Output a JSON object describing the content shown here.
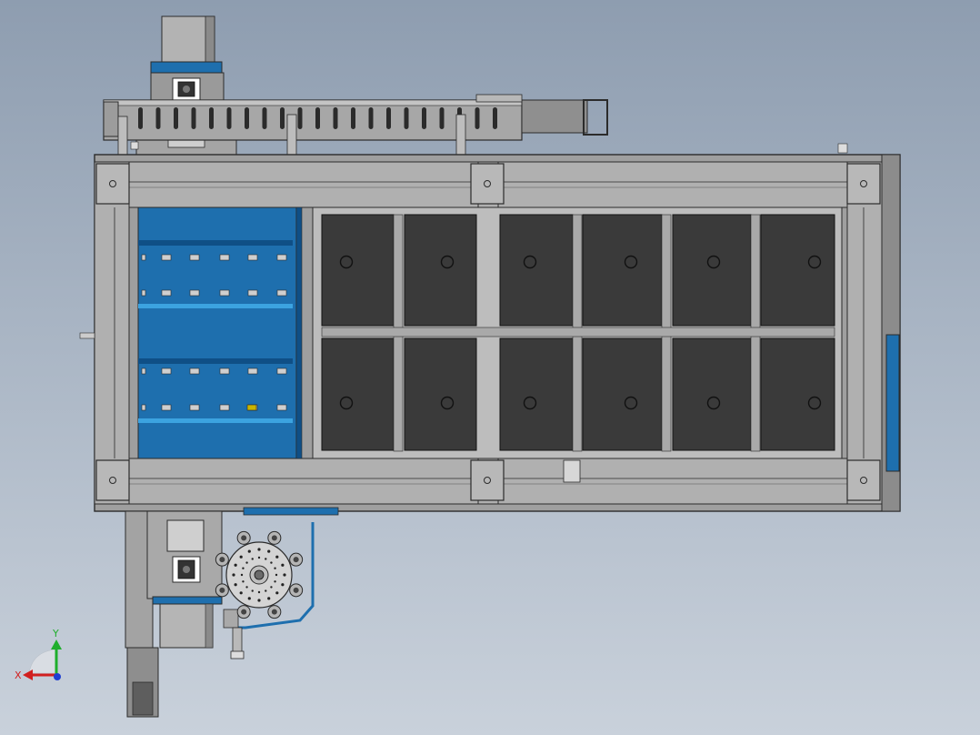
{
  "viewport": {
    "background_top": "#8e9db0",
    "background_bottom": "#c9d1db"
  },
  "colors": {
    "steel": "#a9a9a9",
    "steel_light": "#c4c4c4",
    "steel_dark": "#7c7c7c",
    "edge": "#2b2b2b",
    "panel_dark": "#3a3a3a",
    "blue": "#1e6fae",
    "blue_dark": "#0f4f86",
    "blue_light": "#3ca3e0",
    "axis_x": "#d11f1f",
    "axis_y": "#1fae2c",
    "axis_z": "#1f3fd1"
  },
  "triad": {
    "x_label": "X",
    "y_label": "Y"
  },
  "parts": {
    "cable_chain": "cable-carrier",
    "main_frame": "machine-frame",
    "blue_section": "blue-conveyor-section",
    "tray_grid": "tray-grid",
    "rotary_head": "rotary-star-wheel",
    "motor_top": "servo-motor-top",
    "motor_bottom": "servo-motor-bottom"
  }
}
